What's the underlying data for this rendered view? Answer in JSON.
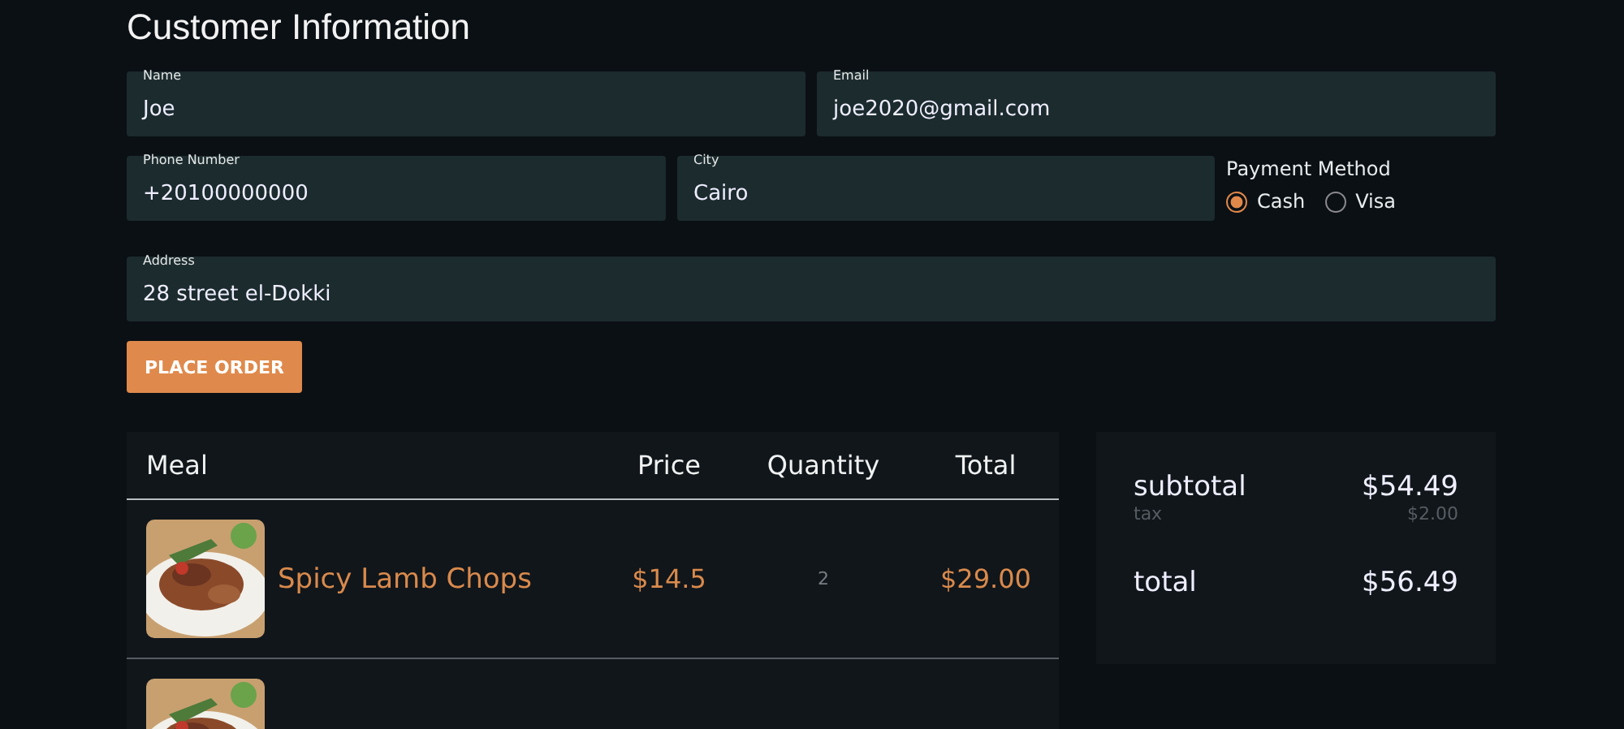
{
  "title": "Customer Information",
  "fields": [
    {
      "label": "Name",
      "value": "Joe"
    },
    {
      "label": "Email",
      "value": "joe2020@gmail.com"
    },
    {
      "label": "Phone Number",
      "value": "+20100000000"
    },
    {
      "label": "City",
      "value": "Cairo"
    },
    {
      "label": "Address",
      "value": "28 street el-Dokki"
    }
  ],
  "payment": {
    "label": "Payment Method",
    "options": [
      {
        "label": "Cash",
        "selected": true
      },
      {
        "label": "Visa",
        "selected": false
      }
    ]
  },
  "place_order_button": "PLACE ORDER",
  "table": {
    "columns": [
      "Meal",
      "Price",
      "Quantity",
      "Total"
    ],
    "rows": [
      {
        "meal": "Spicy Lamb Chops",
        "price": "$14.5",
        "quantity": "2",
        "total": "$29.00",
        "image": {
          "kind": "picture"
        }
      },
      {
        "image": {
          "kind": "picture"
        }
      }
    ]
  },
  "summary": {
    "subtotal_label": "subtotal",
    "subtotal": "$54.49",
    "tax_label": "tax",
    "tax": "$2.00",
    "total_label": "total",
    "total": "$56.49"
  }
}
